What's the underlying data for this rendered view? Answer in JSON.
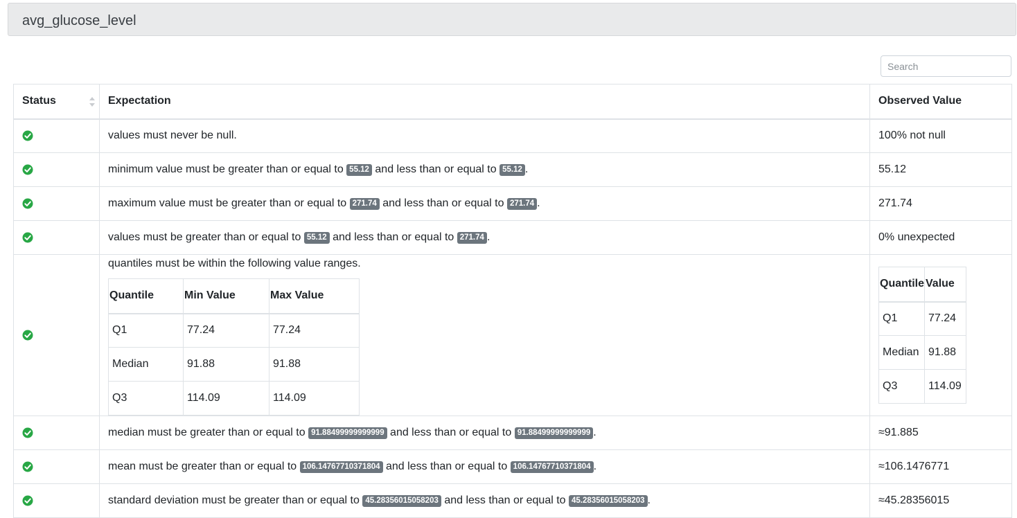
{
  "header": {
    "title": "avg_glucose_level"
  },
  "search": {
    "placeholder": "Search"
  },
  "table": {
    "columns": {
      "status": "Status",
      "expectation": "Expectation",
      "observed": "Observed Value"
    },
    "rows": [
      {
        "status": "success",
        "parts": [
          "values must never be null."
        ],
        "badges": [],
        "observed": "100% not null"
      },
      {
        "status": "success",
        "parts": [
          "minimum value must be greater than or equal to ",
          " and less than or equal to ",
          "."
        ],
        "badges": [
          "55.12",
          "55.12"
        ],
        "observed": "55.12"
      },
      {
        "status": "success",
        "parts": [
          "maximum value must be greater than or equal to ",
          " and less than or equal to ",
          "."
        ],
        "badges": [
          "271.74",
          "271.74"
        ],
        "observed": "271.74"
      },
      {
        "status": "success",
        "parts": [
          "values must be greater than or equal to ",
          " and less than or equal to ",
          "."
        ],
        "badges": [
          "55.12",
          "271.74"
        ],
        "observed": "0% unexpected"
      },
      {
        "status": "success",
        "parts": [
          "median must be greater than or equal to ",
          " and less than or equal to ",
          "."
        ],
        "badges": [
          "91.88499999999999",
          "91.88499999999999"
        ],
        "observed": "≈91.885"
      },
      {
        "status": "success",
        "parts": [
          "mean must be greater than or equal to ",
          " and less than or equal to ",
          "."
        ],
        "badges": [
          "106.14767710371804",
          "106.14767710371804"
        ],
        "observed": "≈106.1476771"
      },
      {
        "status": "success",
        "parts": [
          "standard deviation must be greater than or equal to ",
          " and less than or equal to ",
          "."
        ],
        "badges": [
          "45.28356015058203",
          "45.28356015058203"
        ],
        "observed": "≈45.28356015"
      }
    ],
    "quantile_row": {
      "status": "success",
      "text": "quantiles must be within the following value ranges.",
      "expect_headers": [
        "Quantile",
        "Min Value",
        "Max Value"
      ],
      "expect_rows": [
        [
          "Q1",
          "77.24",
          "77.24"
        ],
        [
          "Median",
          "91.88",
          "91.88"
        ],
        [
          "Q3",
          "114.09",
          "114.09"
        ]
      ],
      "observed_headers": [
        "Quantile",
        "Value"
      ],
      "observed_rows": [
        [
          "Q1",
          "77.24"
        ],
        [
          "Median",
          "91.88"
        ],
        [
          "Q3",
          "114.09"
        ]
      ]
    }
  },
  "colors": {
    "success": "#28a745",
    "badge": "#6c757d"
  },
  "icons": {
    "status_success": "check-circle-icon",
    "sort": "sort-icon"
  }
}
